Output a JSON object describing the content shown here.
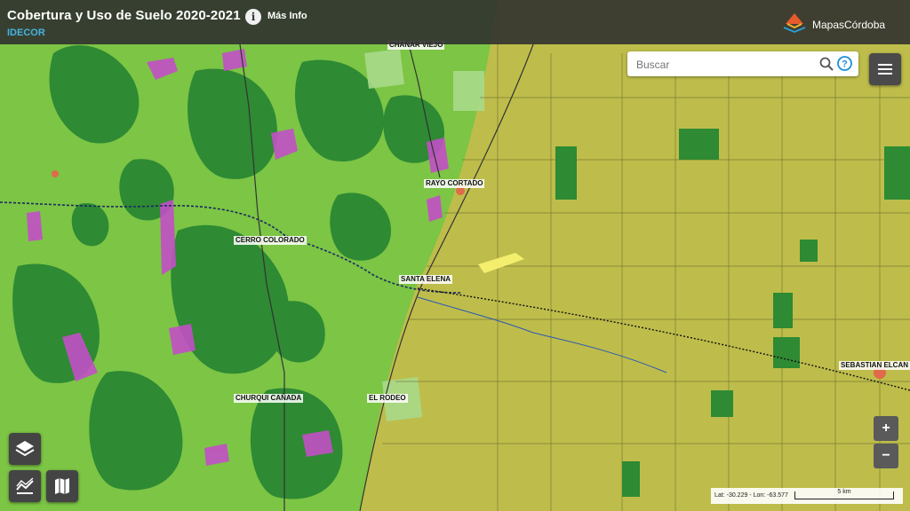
{
  "header": {
    "title": "Cobertura y Uso de Suelo 2020-2021",
    "subtitle": "IDECOR",
    "info_icon": "info-icon",
    "more_info_label": "Más Info",
    "brand_name": "MapasCórdoba"
  },
  "search": {
    "placeholder": "Buscar",
    "value": ""
  },
  "places": {
    "chanar_viejo": "CHAÑAR VIEJO",
    "rayo_cortado": "RAYO CORTADO",
    "cerro_colorado": "CERRO COLORADO",
    "santa_elena": "SANTA ELENA",
    "churqui_canada": "CHURQUI CAÑADA",
    "el_rodeo": "EL RODEO",
    "sebastian_elcano": "SEBASTIAN ELCAN"
  },
  "controls": {
    "zoom_in": "+",
    "zoom_out": "−",
    "layers_icon": "layers-icon",
    "legend_icon": "legend-icon",
    "basemap_icon": "map-icon",
    "menu_icon": "hamburger-icon"
  },
  "status": {
    "coordinates": "Lat: -30.229 - Lon: -63.577",
    "scale_label": "5 km"
  },
  "colors": {
    "header_bg": "#2d2d2d",
    "subtitle": "#44b3e0",
    "forest": "#2f8a32",
    "shrub": "#79c244",
    "crop": "#bebd4b",
    "magenta": "#c24fc6",
    "brand_orange": "#e85a2c",
    "brand_blue": "#2a9fd8"
  }
}
